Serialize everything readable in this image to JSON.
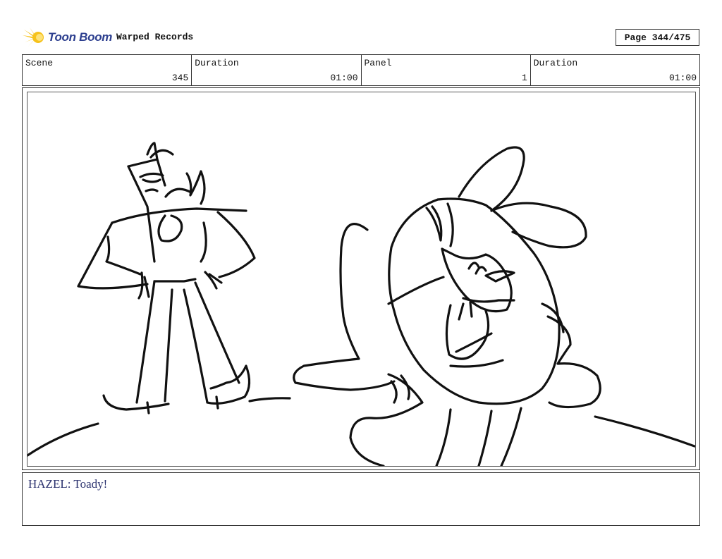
{
  "header": {
    "logo_text": "Toon Boom",
    "project_title": "Warped Records",
    "page_label": "Page 344/475"
  },
  "info": {
    "scene_label": "Scene",
    "scene_value": "345",
    "scene_duration_label": "Duration",
    "scene_duration_value": "01:00",
    "panel_label": "Panel",
    "panel_value": "1",
    "panel_duration_label": "Duration",
    "panel_duration_value": "01:00"
  },
  "dialog": {
    "text": "HAZEL: Toady!"
  },
  "colors": {
    "logo_blue": "#2d3f8f",
    "logo_yellow": "#f6c21b",
    "dialog_text": "#2d3470"
  }
}
